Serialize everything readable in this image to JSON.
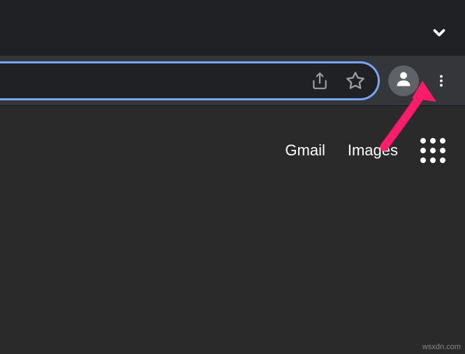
{
  "links": {
    "gmail": "Gmail",
    "images": "Images"
  },
  "watermark": "wsxdn.com"
}
